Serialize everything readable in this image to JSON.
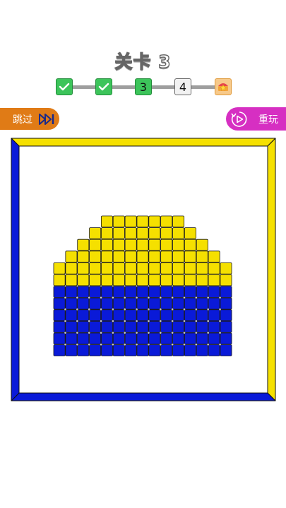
{
  "level": {
    "title": "关卡 3"
  },
  "progress": {
    "steps": [
      {
        "state": "done",
        "label": ""
      },
      {
        "state": "done",
        "label": ""
      },
      {
        "state": "current",
        "label": "3"
      },
      {
        "state": "next",
        "label": "4"
      },
      {
        "state": "reward",
        "label": ""
      }
    ]
  },
  "buttons": {
    "skip_label": "跳过",
    "replay_label": "重玩"
  },
  "board": {
    "frame_colors": {
      "top_right": "#f5e000",
      "bottom_left": "#0a1ad8"
    },
    "grid": {
      "columns": 15,
      "rows": 12,
      "row_spans": [
        [
          4,
          10
        ],
        [
          3,
          11
        ],
        [
          2,
          12
        ],
        [
          1,
          13
        ],
        [
          0,
          14
        ],
        [
          0,
          14
        ],
        [
          0,
          14
        ],
        [
          0,
          14
        ],
        [
          0,
          14
        ],
        [
          0,
          14
        ],
        [
          0,
          14
        ],
        [
          0,
          14
        ]
      ],
      "yellow_rows": 6,
      "blue_rows": 6,
      "colors": {
        "yellow": "#f5e000",
        "blue": "#0a1ad8"
      }
    }
  }
}
